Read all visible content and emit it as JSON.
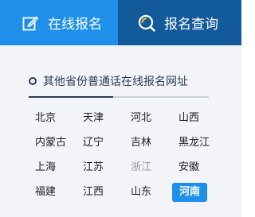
{
  "tabs": [
    {
      "label": "在线报名",
      "icon": "edit-icon",
      "active": true
    },
    {
      "label": "报名查询",
      "icon": "search-icon",
      "active": false
    }
  ],
  "section": {
    "title": "其他省份普通话在线报名网址"
  },
  "colors": {
    "active_tab": "#1e90ea",
    "inactive_tab": "#135a9b",
    "highlight": "#1e90ea",
    "heading": "#2a3d57"
  },
  "provinces": [
    {
      "name": "北京"
    },
    {
      "name": "天津"
    },
    {
      "name": "河北"
    },
    {
      "name": "山西"
    },
    {
      "name": "内蒙古"
    },
    {
      "name": "辽宁"
    },
    {
      "name": "吉林"
    },
    {
      "name": "黑龙江"
    },
    {
      "name": "上海"
    },
    {
      "name": "江苏"
    },
    {
      "name": "浙江",
      "state": "dim"
    },
    {
      "name": "安徽"
    },
    {
      "name": "福建"
    },
    {
      "name": "江西"
    },
    {
      "name": "山东"
    },
    {
      "name": "河南",
      "state": "active"
    }
  ]
}
